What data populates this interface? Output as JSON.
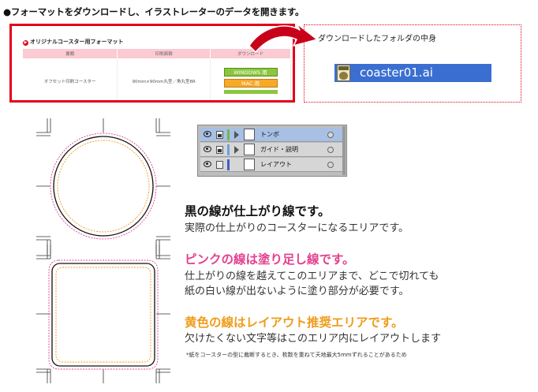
{
  "heading": "●フォーマットをダウンロードし、イラストレーターのデータを開きます。",
  "left_shot": {
    "section_title": "オリジナルコースター用フォーマット",
    "bullet_glyph": "▶",
    "columns": [
      "書類",
      "印刷面積",
      "ダウンロード"
    ],
    "row": {
      "doc": "オフセット印刷コースター",
      "size": "90mm×90mm丸型／角丸型8R",
      "win_button": "WINDOWS 用",
      "mac_button": "MAC 用"
    }
  },
  "right_shot": {
    "folder_label": "ダウンロードしたフォルダの中身",
    "file_name": "coaster01.ai"
  },
  "layers": [
    {
      "name": "トンボ",
      "selected": true,
      "locked": true,
      "color": "#7ab54a"
    },
    {
      "name": "ガイド・説明",
      "selected": false,
      "locked": true,
      "color": "#6aa3d8"
    },
    {
      "name": "レイアウト",
      "selected": false,
      "locked": false,
      "color": "#3f5fbf"
    }
  ],
  "explanations": {
    "black_title": "黒の線が仕上がり線です。",
    "black_body": "実際の仕上がりのコースターになるエリアです。",
    "pink_title": "ピンクの線は塗り足し線です。",
    "pink_body_1": "仕上がりの線を越えてこのエリアまで、どこで切れても",
    "pink_body_2": "紙の白い線が出ないように塗り部分が必要です。",
    "yellow_title": "黄色の線はレイアウト推奨エリアです。",
    "yellow_body": "欠けたくない文字等はこのエリア内にレイアウトします",
    "footnote": "*紙をコースターの型に裁断するとき、枚数を重ねて天地最大5mmずれることがあるため"
  },
  "colors": {
    "red": "#e2001a",
    "pink": "#e4418f",
    "yellow": "#ef9c1b",
    "selected_layer": "#a7c0e3",
    "file_highlight": "#3a6fd1"
  }
}
